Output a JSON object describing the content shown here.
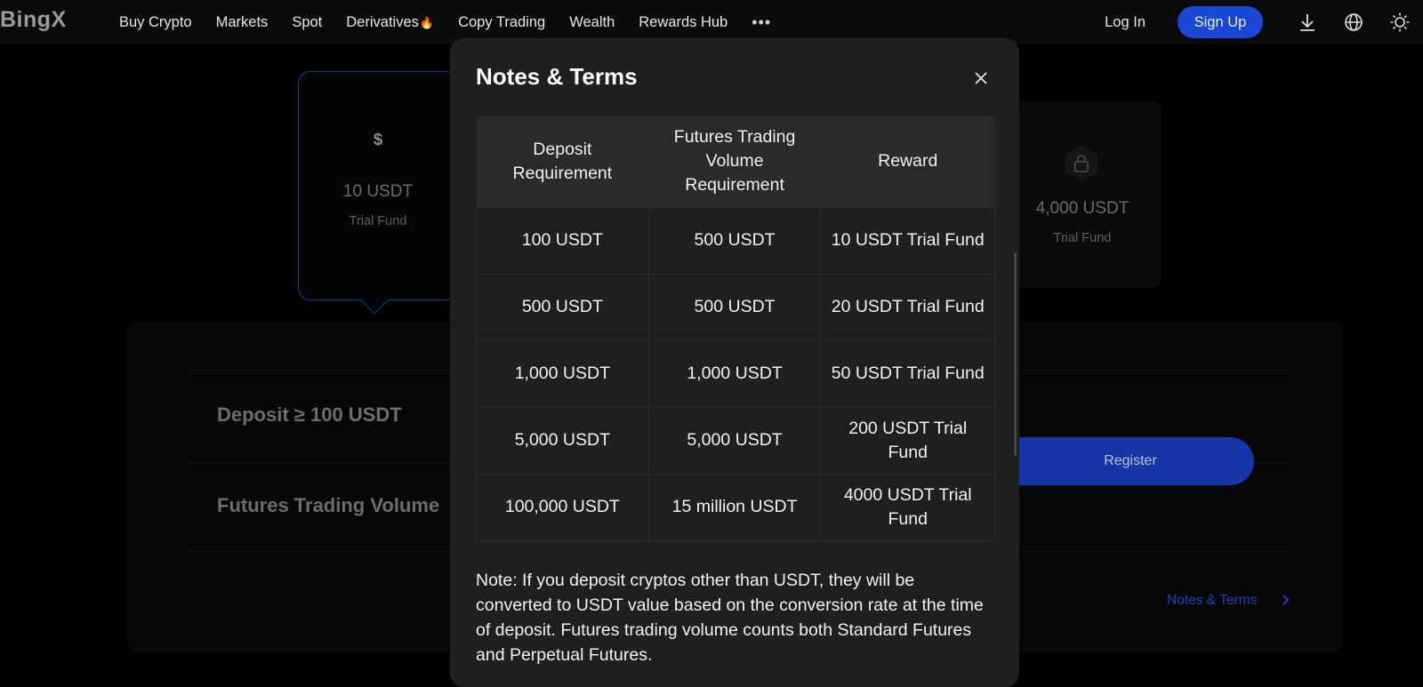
{
  "nav": {
    "logo": "BingX",
    "links": [
      "Buy Crypto",
      "Markets",
      "Spot",
      "Derivatives",
      "Copy Trading",
      "Wealth",
      "Rewards Hub"
    ],
    "more": "•••",
    "login": "Log In",
    "signup": "Sign Up"
  },
  "background": {
    "card_active": {
      "icon": "$",
      "amount": "10 USDT",
      "label": "Trial Fund"
    },
    "card_locked": {
      "amount": "4,000 USDT",
      "label": "Trial Fund"
    },
    "deposit_label": "Deposit ≥ 100 USDT",
    "futures_label": "Futures Trading Volume",
    "register_label": "Register",
    "notes_link": "Notes & Terms"
  },
  "modal": {
    "title": "Notes & Terms",
    "headers": [
      "Deposit Requirement",
      "Futures Trading Volume Requirement",
      "Reward"
    ],
    "rows": [
      [
        "100 USDT",
        "500 USDT",
        "10 USDT Trial Fund"
      ],
      [
        "500 USDT",
        "500 USDT",
        "20 USDT Trial Fund"
      ],
      [
        "1,000 USDT",
        "1,000 USDT",
        "50 USDT Trial Fund"
      ],
      [
        "5,000 USDT",
        "5,000 USDT",
        "200 USDT Trial Fund"
      ],
      [
        "100,000 USDT",
        "15 million USDT",
        "4000 USDT Trial Fund"
      ]
    ],
    "note": "Note: If you deposit cryptos other than USDT, they will be converted to USDT value based on the conversion rate at the time of deposit. Futures trading volume counts both Standard Futures and Perpetual Futures."
  },
  "colors": {
    "accent": "#1a47d6",
    "modal_bg": "#1f1f20",
    "table_header_bg": "#2a2a2b"
  }
}
